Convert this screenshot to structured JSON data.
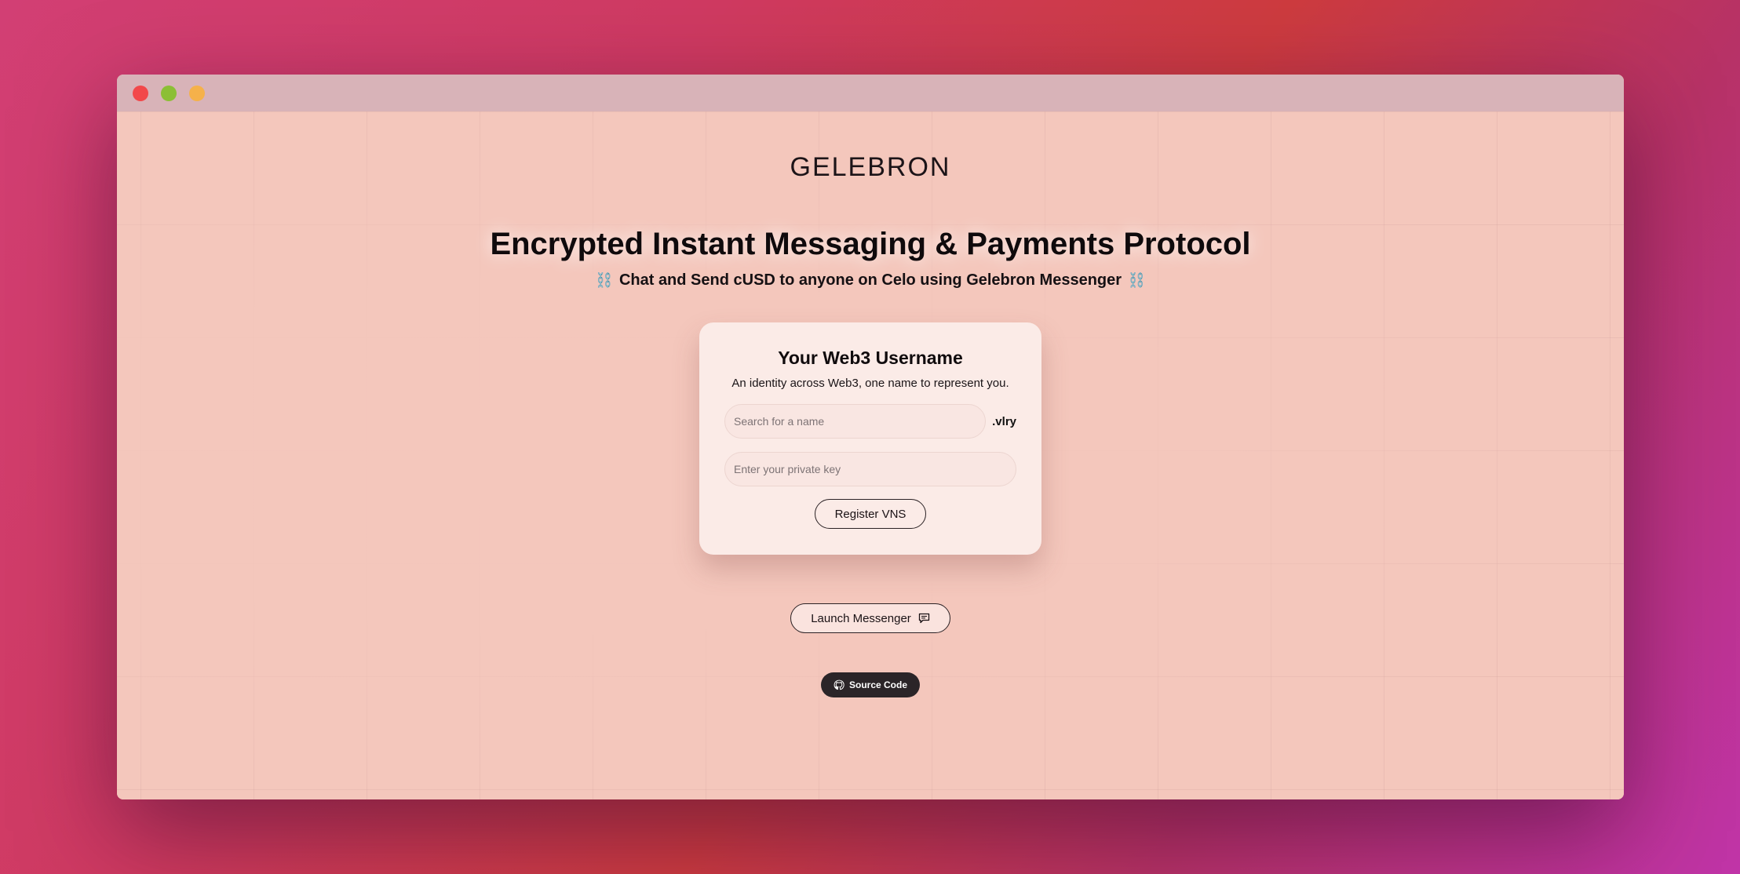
{
  "window": {
    "controls": [
      {
        "name": "close",
        "color": "#f2484a"
      },
      {
        "name": "minimize",
        "color": "#8cbf35"
      },
      {
        "name": "zoom",
        "color": "#f5b14a"
      }
    ]
  },
  "brand": {
    "logo": "GELEBRON"
  },
  "hero": {
    "title": "Encrypted Instant Messaging & Payments Protocol",
    "subtitle": "Chat and Send cUSD to anyone on Celo using Gelebron Messenger",
    "left_emoji": "⛓️",
    "right_emoji": "⛓️"
  },
  "card": {
    "title": "Your Web3 Username",
    "description": "An identity across Web3, one name to represent you.",
    "name_input": {
      "placeholder": "Search for a name",
      "value": ""
    },
    "suffix": ".vlry",
    "key_input": {
      "placeholder": "Enter your private key",
      "value": ""
    },
    "register_label": "Register VNS"
  },
  "actions": {
    "launch_label": "Launch Messenger",
    "launch_icon": "chat-bubble-icon",
    "source_label": "Source Code",
    "source_icon": "github-icon"
  }
}
